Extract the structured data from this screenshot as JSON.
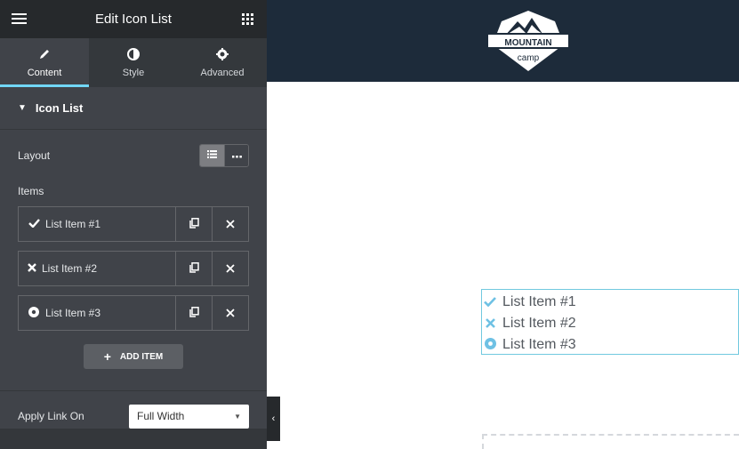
{
  "panel": {
    "title": "Edit Icon List",
    "tabs": [
      {
        "label": "Content",
        "icon": "pencil-icon"
      },
      {
        "label": "Style",
        "icon": "half-circle-icon"
      },
      {
        "label": "Advanced",
        "icon": "gear-icon"
      }
    ],
    "section": {
      "title": "Icon List"
    },
    "layout_label": "Layout",
    "items_label": "Items",
    "items": [
      {
        "label": "List Item #1",
        "icon": "check-icon"
      },
      {
        "label": "List Item #2",
        "icon": "times-icon"
      },
      {
        "label": "List Item #3",
        "icon": "dot-circle-icon"
      }
    ],
    "add_item_label": "ADD ITEM",
    "apply_link_label": "Apply Link On",
    "apply_link_value": "Full Width"
  },
  "preview": {
    "logo": {
      "line1": "MOUNTAIN",
      "line2": "camp"
    },
    "list": [
      {
        "label": "List Item #1",
        "icon": "check-icon"
      },
      {
        "label": "List Item #2",
        "icon": "times-icon"
      },
      {
        "label": "List Item #3",
        "icon": "dot-circle-icon"
      }
    ]
  },
  "colors": {
    "panel_bg": "#404349",
    "topbar_bg": "#26292c",
    "accent": "#71d7f7",
    "header_bg": "#1d2b3a",
    "icon_color": "#6ec1e4"
  }
}
